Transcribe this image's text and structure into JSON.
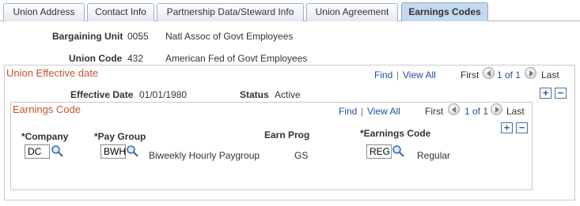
{
  "tabs": [
    {
      "label": "Union Address",
      "underline_char": "A"
    },
    {
      "label": "Contact Info"
    },
    {
      "label": "Partnership Data/Steward Info"
    },
    {
      "label": "Union Agreement"
    },
    {
      "label": "Earnings Codes",
      "active": true
    }
  ],
  "header": {
    "bargaining_unit_label": "Bargaining Unit",
    "bargaining_unit_code": "0055",
    "bargaining_unit_desc": "Natl Assoc of Govt Employees",
    "union_code_label": "Union Code",
    "union_code_value": "432",
    "union_code_desc": "American Fed of Govt Employees"
  },
  "union_effective": {
    "title": "Union Effective date",
    "find": "Find",
    "separator": "|",
    "view_all": "View All",
    "first": "First",
    "range": "1 of 1",
    "last": "Last",
    "effective_date_label": "Effective Date",
    "effective_date_value": "01/01/1980",
    "status_label": "Status",
    "status_value": "Active",
    "add_symbol": "+",
    "remove_symbol": "−"
  },
  "earnings_code": {
    "title": "Earnings Code",
    "find": "Find",
    "separator": "|",
    "view_all": "View All",
    "first": "First",
    "range": "1 of 1",
    "last": "Last",
    "company_label": "*Company",
    "company_value": "DC",
    "pay_group_label": "*Pay Group",
    "pay_group_value": "BWH",
    "pay_group_desc": "Biweekly Hourly Paygroup",
    "earn_prog_label": "Earn Prog",
    "earn_prog_value": "GS",
    "earnings_code_label": "*Earnings Code",
    "earnings_code_value": "REG",
    "earnings_code_desc": "Regular",
    "add_symbol": "+",
    "remove_symbol": "−"
  },
  "icons": {
    "lookup": "magnifier-icon",
    "prev": "chevron-left-icon",
    "next": "chevron-right-icon"
  },
  "colors": {
    "active_tab": "#c4d8ef",
    "section_title": "#c0552b",
    "link": "#1f4fa0"
  }
}
